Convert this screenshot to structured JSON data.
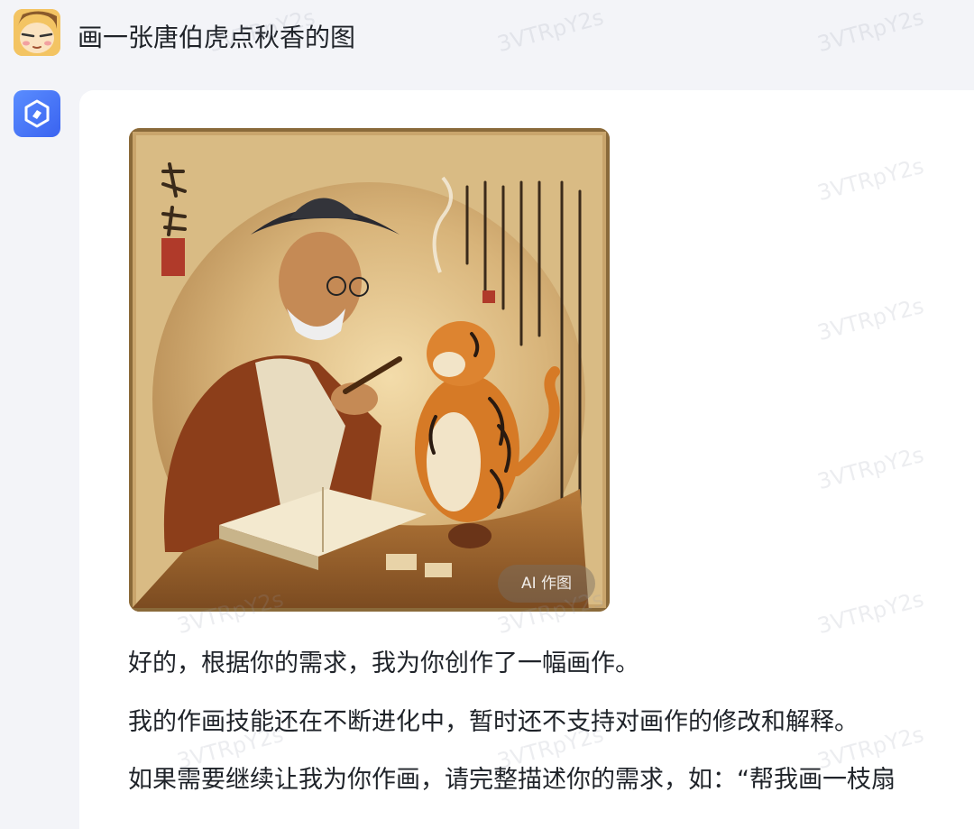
{
  "user": {
    "avatar_icon": "cartoon-face-icon",
    "message": "画一张唐伯虎点秋香的图"
  },
  "assistant": {
    "avatar_icon": "cube-logo-icon",
    "image_badge": "AI 作图",
    "lines": [
      "好的，根据你的需求，我为你创作了一幅画作。",
      "我的作画技能还在不断进化中，暂时还不支持对画作的修改和解释。",
      "如果需要继续让我为你作画，请完整描述你的需求，如：“帮我画一枝扇"
    ]
  },
  "watermark_text": "3VTRpY2s",
  "colors": {
    "page_bg": "#f3f4f8",
    "card_bg": "#ffffff",
    "text": "#1f2329",
    "bot_accent": "#3a63f0"
  }
}
